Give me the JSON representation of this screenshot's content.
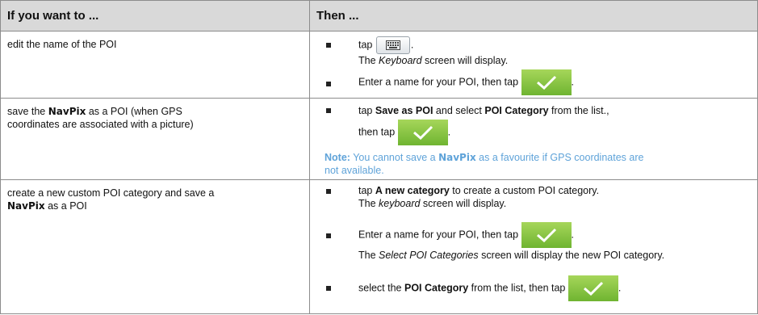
{
  "header": {
    "col1": "If you want to ...",
    "col2": "Then ..."
  },
  "rows": [
    {
      "left": "edit the name of the POI",
      "steps": [
        {
          "tap": "tap",
          "after": ".",
          "line2_a": "The ",
          "line2_i": "Keyboard",
          "line2_b": " screen will display."
        },
        {
          "text": "Enter a name for your POI, then tap",
          "after": "."
        }
      ]
    },
    {
      "left_a": "save the ",
      "left_navpix": "NavPix",
      "left_b": " as a POI (when GPS",
      "left_line2": "coordinates are associated with a picture)",
      "step": {
        "a": "tap ",
        "b1": "Save as POI",
        "c": " and select ",
        "b2": "POI Category",
        "d": " from the list.,",
        "then": "then  tap",
        "after": "."
      },
      "note": {
        "label": "Note:",
        "a": " You cannot save a ",
        "navpix": "NavPix",
        "b": " as a favourite if GPS coordinates are",
        "line2": "not available."
      }
    },
    {
      "left_line1": "create a new custom POI category and save a",
      "left_navpix": "NavPix",
      "left_b": " as a POI",
      "steps": [
        {
          "a": "tap ",
          "bold": "A new category",
          "b": " to create a custom POI category.",
          "line2_a": "The ",
          "line2_i": "keyboard",
          "line2_b": " screen will display."
        },
        {
          "text": "Enter a name for your POI, then tap",
          "after": ".",
          "line2_a": "The ",
          "line2_i": "Select POI Categories",
          "line2_b": " screen will display the new POI category."
        },
        {
          "a": "select the ",
          "bold": "POI Category",
          "b": " from the list, then  tap",
          "after": "."
        }
      ]
    }
  ],
  "icons": {
    "keyboard": "keyboard-icon",
    "confirm": "checkmark-icon"
  },
  "colors": {
    "header_bg": "#d9d9d9",
    "note": "#5fa3d9",
    "ok_green": "#8cc63f",
    "border": "#8c8c8c"
  }
}
